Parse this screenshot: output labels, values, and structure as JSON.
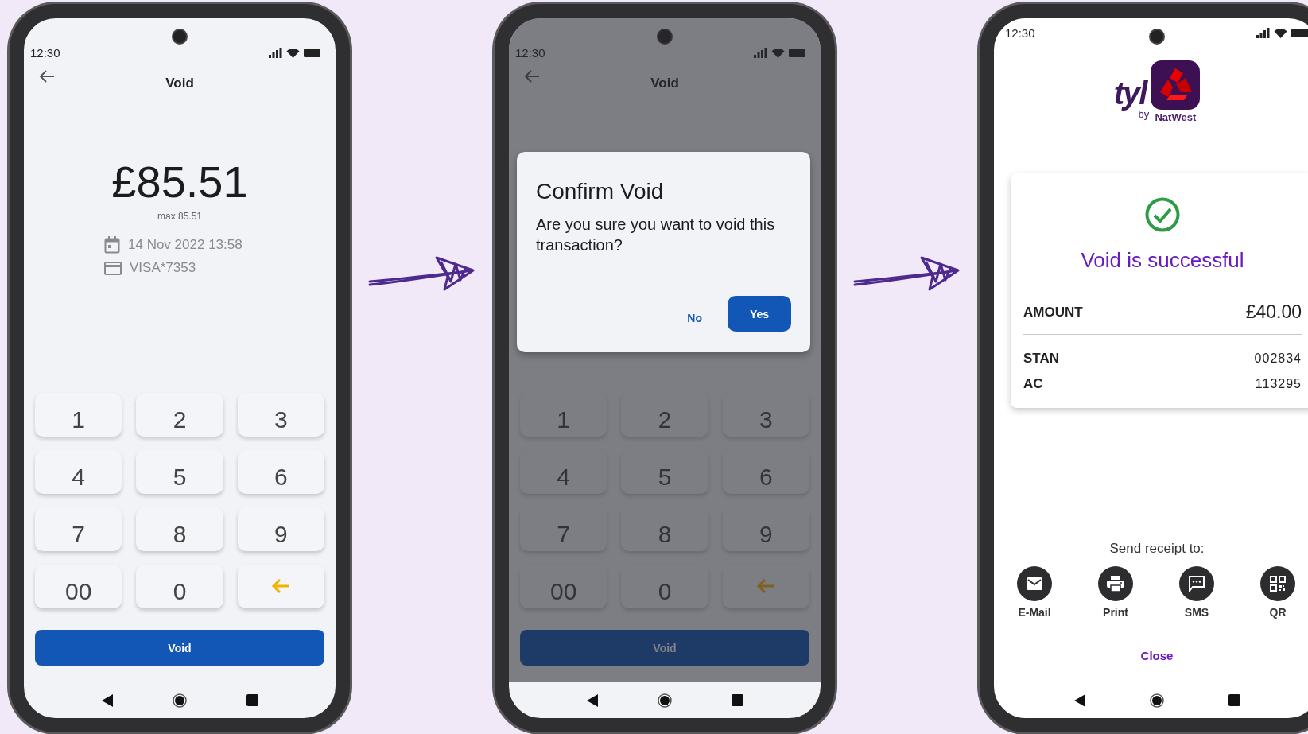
{
  "screens": [
    {
      "kind": "amount_entry",
      "status_time": "12:30",
      "title": "Void",
      "amount": "£85.51",
      "max_label": "max 85.51",
      "details": [
        {
          "kind": "date",
          "text": "14 Nov 2022 13:58"
        },
        {
          "kind": "card",
          "text": "VISA*7353"
        }
      ],
      "keypad": [
        {
          "kind": "digit",
          "label": "1"
        },
        {
          "kind": "digit",
          "label": "2"
        },
        {
          "kind": "digit",
          "label": "3"
        },
        {
          "kind": "digit",
          "label": "4"
        },
        {
          "kind": "digit",
          "label": "5"
        },
        {
          "kind": "digit",
          "label": "6"
        },
        {
          "kind": "digit",
          "label": "7"
        },
        {
          "kind": "digit",
          "label": "8"
        },
        {
          "kind": "digit",
          "label": "9"
        },
        {
          "kind": "digit",
          "label": "00"
        },
        {
          "kind": "digit",
          "label": "0"
        },
        {
          "kind": "backspace"
        }
      ],
      "action_button": "Void"
    },
    {
      "kind": "amount_entry",
      "status_time": "12:30",
      "title": "Void",
      "keypad": [
        {
          "kind": "digit",
          "label": "1"
        },
        {
          "kind": "digit",
          "label": "2"
        },
        {
          "kind": "digit",
          "label": "3"
        },
        {
          "kind": "digit",
          "label": "4"
        },
        {
          "kind": "digit",
          "label": "5"
        },
        {
          "kind": "digit",
          "label": "6"
        },
        {
          "kind": "digit",
          "label": "7"
        },
        {
          "kind": "digit",
          "label": "8"
        },
        {
          "kind": "digit",
          "label": "9"
        },
        {
          "kind": "digit",
          "label": "00"
        },
        {
          "kind": "digit",
          "label": "0"
        },
        {
          "kind": "backspace"
        }
      ],
      "action_button": "Void",
      "dialog": {
        "title": "Confirm Void",
        "message": "Are you sure you want to void this transaction?",
        "buttons": [
          {
            "kind": "text",
            "label": "No"
          },
          {
            "kind": "filled",
            "label": "Yes"
          }
        ]
      }
    },
    {
      "kind": "receipt",
      "status_time": "12:30",
      "logo": {
        "wordmark": "tyl",
        "by": "by",
        "bank": "NatWest"
      },
      "result_title": "Void is successful",
      "rows": [
        {
          "kind": "total",
          "label": "AMOUNT",
          "value": "£40.00"
        },
        {
          "kind": "detail",
          "label": "STAN",
          "value": "002834"
        },
        {
          "kind": "detail",
          "label": "AC",
          "value": "113295"
        }
      ],
      "send_label": "Send receipt to:",
      "send_options": [
        {
          "kind": "email",
          "label": "E-Mail"
        },
        {
          "kind": "print",
          "label": "Print"
        },
        {
          "kind": "sms",
          "label": "SMS"
        },
        {
          "kind": "qr",
          "label": "QR"
        }
      ],
      "close_label": "Close"
    }
  ]
}
